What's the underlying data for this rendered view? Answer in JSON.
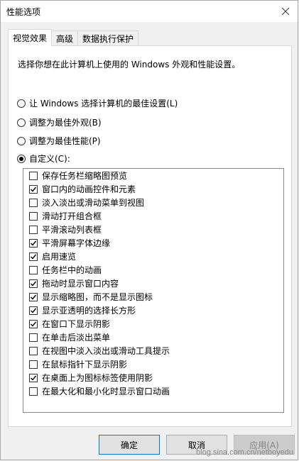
{
  "window": {
    "title": "性能选项"
  },
  "tabs": [
    {
      "label": "视觉效果",
      "active": true
    },
    {
      "label": "高级",
      "active": false
    },
    {
      "label": "数据执行保护",
      "active": false
    }
  ],
  "description": "选择你想在此计算机上使用的 Windows 外观和性能设置。",
  "radios": [
    {
      "label": "让 Windows 选择计算机的最佳设置(L)",
      "checked": false
    },
    {
      "label": "调整为最佳外观(B)",
      "checked": false
    },
    {
      "label": "调整为最佳性能(P)",
      "checked": false
    },
    {
      "label": "自定义(C):",
      "checked": true
    }
  ],
  "options": [
    {
      "label": "保存任务栏缩略图预览",
      "checked": false
    },
    {
      "label": "窗口内的动画控件和元素",
      "checked": true
    },
    {
      "label": "淡入淡出或滑动菜单到视图",
      "checked": false
    },
    {
      "label": "滑动打开组合框",
      "checked": false
    },
    {
      "label": "平滑滚动列表框",
      "checked": false
    },
    {
      "label": "平滑屏幕字体边缘",
      "checked": true
    },
    {
      "label": "启用速览",
      "checked": true
    },
    {
      "label": "任务栏中的动画",
      "checked": false
    },
    {
      "label": "拖动时显示窗口内容",
      "checked": true
    },
    {
      "label": "显示缩略图，而不是显示图标",
      "checked": true
    },
    {
      "label": "显示亚透明的选择长方形",
      "checked": true
    },
    {
      "label": "在窗口下显示阴影",
      "checked": true
    },
    {
      "label": "在单击后淡出菜单",
      "checked": false
    },
    {
      "label": "在视图中淡入淡出或滑动工具提示",
      "checked": false
    },
    {
      "label": "在鼠标指针下显示阴影",
      "checked": false
    },
    {
      "label": "在桌面上为图标标签使用阴影",
      "checked": true
    },
    {
      "label": "在最大化和最小化时显示窗口动画",
      "checked": false
    }
  ],
  "buttons": {
    "ok": "确定",
    "cancel": "取消",
    "apply": "应用(A)"
  },
  "watermark": "blog.sina.com.cn/netboyedu"
}
